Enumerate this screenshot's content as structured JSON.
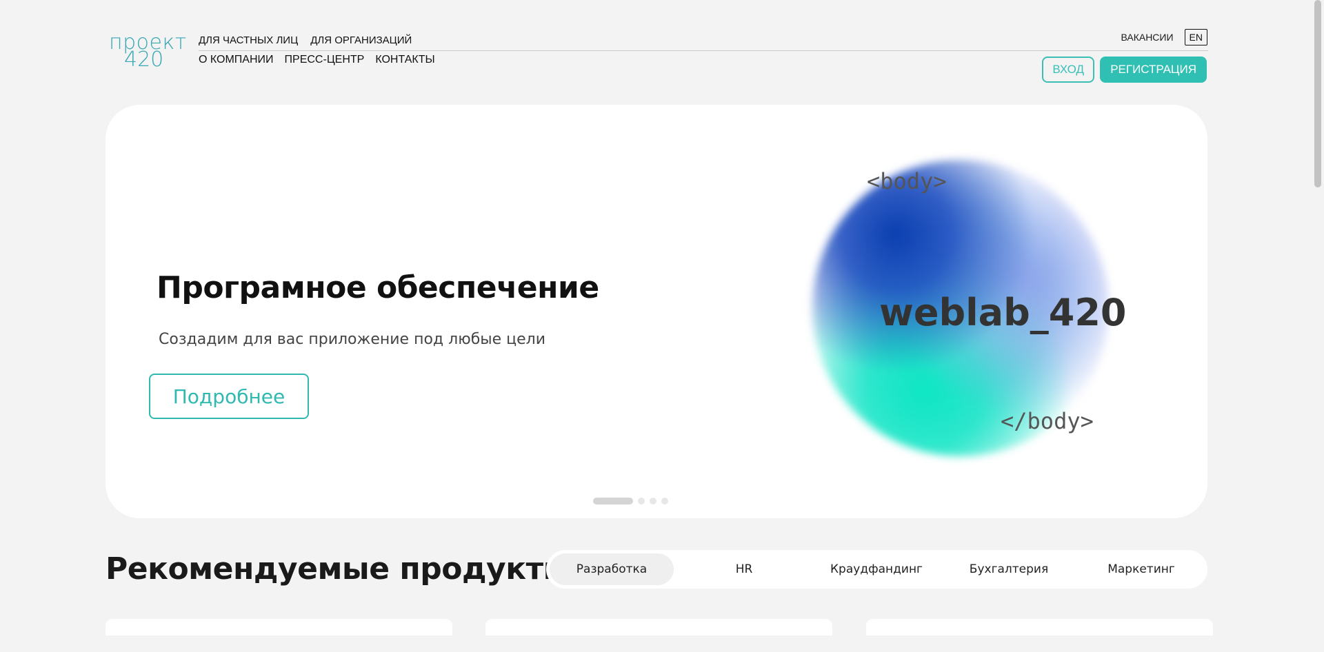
{
  "header": {
    "logo": {
      "line1": "проект",
      "line2": "420"
    },
    "nav_top": [
      "для частных лиц",
      "для организаций"
    ],
    "nav_bottom": [
      "о компании",
      "пресс-центр",
      "контакты"
    ],
    "vacancies": "вакансии",
    "lang": "EN",
    "login": "вход",
    "register": "регистрация"
  },
  "hero": {
    "title": "Програмное обеспечение",
    "subtitle": "Создадим для вас приложение под любые цели",
    "button": "Подробнее",
    "code_open": "<body>",
    "brand": "weblab_420",
    "code_close": "</body>",
    "slides_total": 4,
    "active_slide": 1
  },
  "products": {
    "title": "Рекомендуемые продукты",
    "tabs": [
      "Разработка",
      "HR",
      "Краудфандинг",
      "Бухгалтерия",
      "Маркетинг"
    ],
    "active_tab": "Разработка"
  },
  "colors": {
    "accent": "#2fc0b3",
    "logo": "#3aa7b4",
    "background": "#f3f3f3"
  }
}
